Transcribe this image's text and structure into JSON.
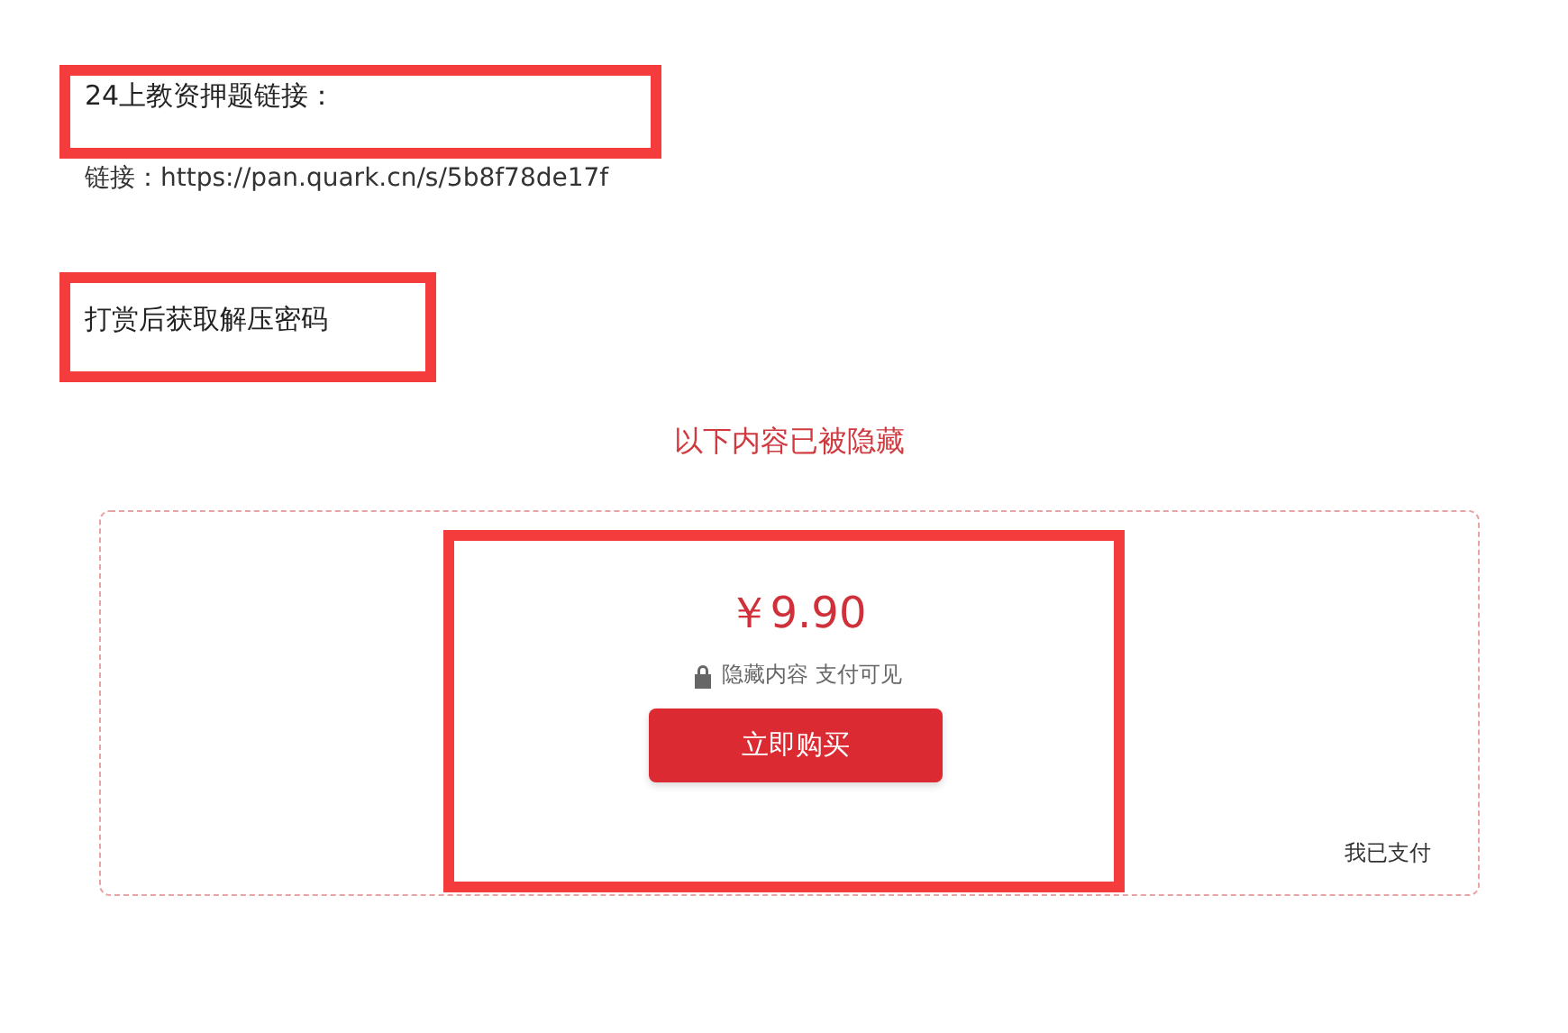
{
  "post": {
    "heading": "24上教资押题链接：",
    "link": "链接：https://pan.quark.cn/s/5b8f78de17f",
    "note": "打赏后获取解压密码"
  },
  "paywall": {
    "title": "以下内容已被隐藏",
    "price": "￥9.90",
    "hint": "隐藏内容 支付可见",
    "buy_button": "立即购买",
    "paid_link": "我已支付"
  }
}
